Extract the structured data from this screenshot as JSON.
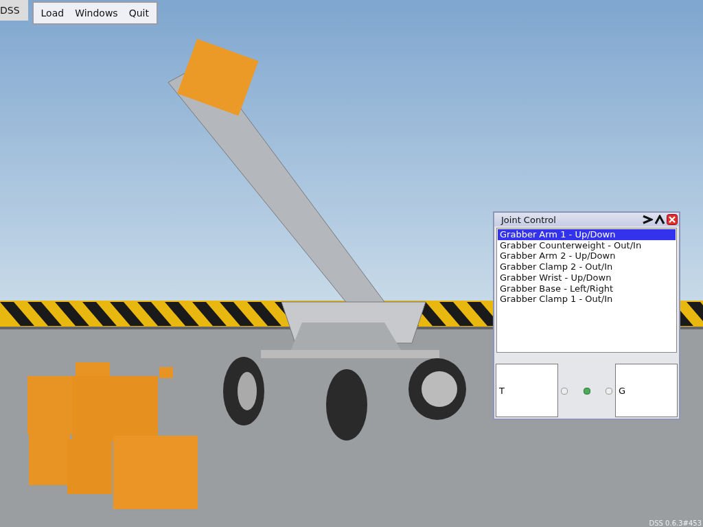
{
  "app_button": {
    "label": "DSS"
  },
  "menu": {
    "items": [
      "Load",
      "Windows",
      "Quit"
    ]
  },
  "joint_control": {
    "title": "Joint Control",
    "joints": [
      {
        "label": "Grabber Arm 1 - Up/Down",
        "selected": true
      },
      {
        "label": "Grabber Counterweight - Out/In",
        "selected": false
      },
      {
        "label": "Grabber Arm 2 - Up/Down",
        "selected": false
      },
      {
        "label": "Grabber Clamp 2 - Out/In",
        "selected": false
      },
      {
        "label": "Grabber Wrist - Up/Down",
        "selected": false
      },
      {
        "label": "Grabber Base - Left/Right",
        "selected": false
      },
      {
        "label": "Grabber Clamp 1 - Out/In",
        "selected": false
      }
    ],
    "left_field": {
      "value": "T"
    },
    "right_field": {
      "value": "G"
    },
    "mode_options": [
      {
        "selected": false
      },
      {
        "selected": true
      },
      {
        "selected": false
      }
    ]
  },
  "version": "DSS 0.6.3#453"
}
